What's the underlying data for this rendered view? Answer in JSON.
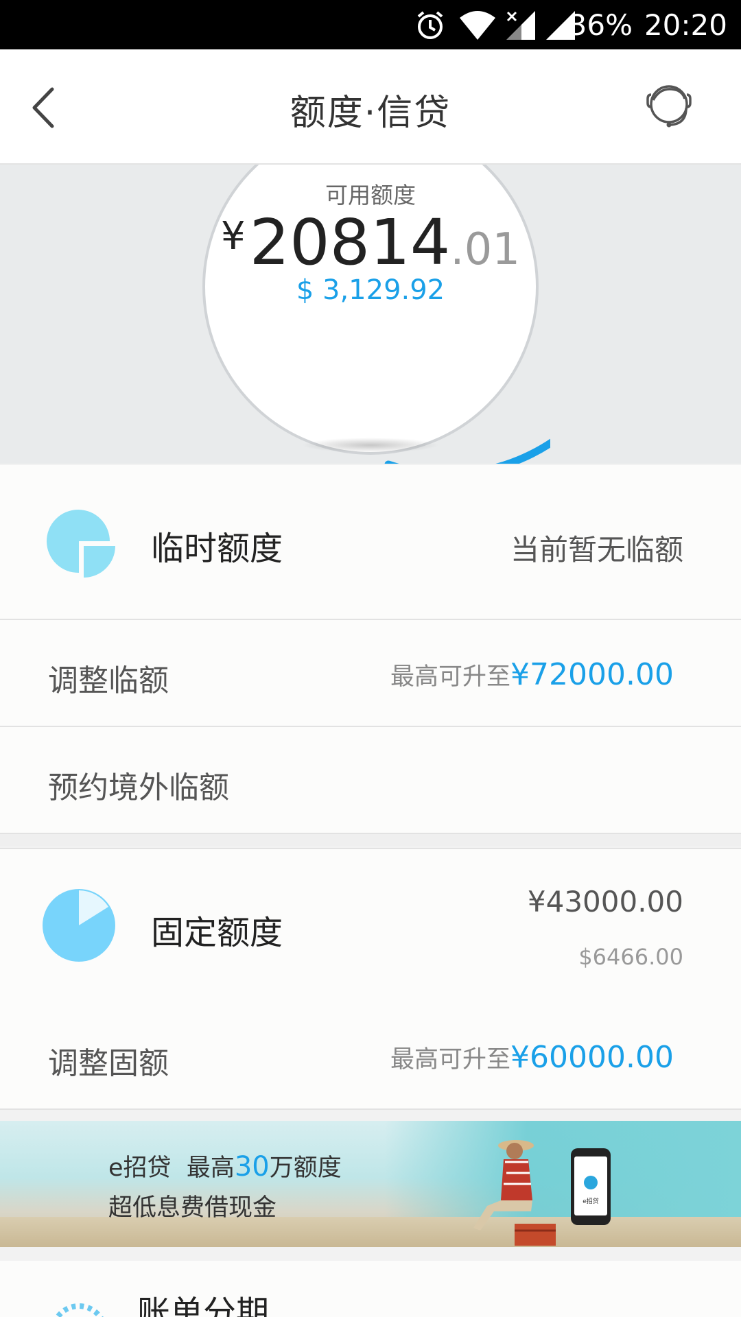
{
  "status_bar": {
    "battery": "36%",
    "time": "20:20"
  },
  "nav": {
    "title": "额度·信贷"
  },
  "available": {
    "label": "可用额度",
    "currency_symbol": "¥",
    "integer_part": "20814",
    "decimal_part": ".01",
    "usd": "$ 3,129.92",
    "ring_progress": 0.36,
    "ring_color": "#1aa0e8"
  },
  "temp_quota": {
    "title": "临时额度",
    "status": "当前暂无临额"
  },
  "adjust_temp": {
    "label": "调整临额",
    "hint": "最高可升至",
    "max": "¥72000.00"
  },
  "book_overseas": {
    "label": "预约境外临额"
  },
  "fixed_quota": {
    "title": "固定额度",
    "cny": "¥43000.00",
    "usd": "$6466.00"
  },
  "adjust_fixed": {
    "label": "调整固额",
    "hint": "最高可升至",
    "max": "¥60000.00"
  },
  "banner": {
    "product": "e招贷",
    "headline_prefix": "最高",
    "headline_number": "30",
    "headline_suffix": "万额度",
    "subline": "超低息费借现金",
    "phone_brand": "e招贷"
  },
  "installment": {
    "title": "账单分期"
  },
  "colors": {
    "accent": "#1aa0e8",
    "icon_light_blue": "#8fe0f5"
  }
}
